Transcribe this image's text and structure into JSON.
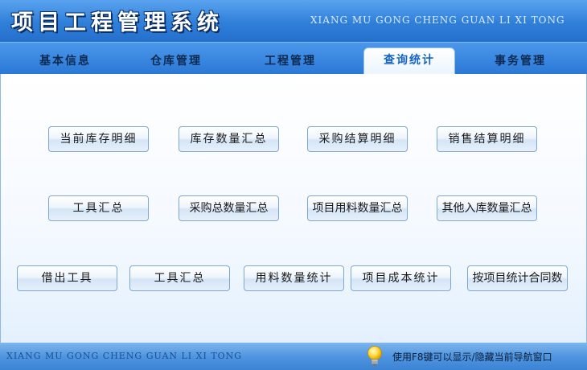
{
  "header": {
    "title": "项目工程管理系统",
    "subtitle": "XIANG MU GONG CHENG GUAN LI XI TONG"
  },
  "nav": {
    "tabs": [
      {
        "label": "基本信息"
      },
      {
        "label": "仓库管理"
      },
      {
        "label": "工程管理"
      },
      {
        "label": "查询统计"
      },
      {
        "label": "事务管理"
      }
    ],
    "active": "查询统计"
  },
  "buttons": {
    "current_stock_detail": "当前库存明细",
    "stock_quantity_summary": "库存数量汇总",
    "purchase_settlement_detail": "采购结算明细",
    "sales_settlement_detail": "销售结算明细",
    "tool_summary_1": "工具汇总",
    "purchase_total_quantity_summary": "采购总数量汇总",
    "project_material_quantity_summary": "项目用料数量汇总",
    "other_inbound_quantity_summary": "其他入库数量汇总",
    "borrowed_tools": "借出工具",
    "tool_summary_2": "工具汇总",
    "material_quantity_statistics": "用料数量统计",
    "project_cost_statistics": "项目成本统计",
    "contracts_by_project": "按项目统计合同数"
  },
  "footer": {
    "text": "XIANG MU GONG CHENG GUAN LI XI TONG",
    "hint": "使用F8键可以显示/隐藏当前导航窗口",
    "icon": "lightbulb-icon"
  },
  "colors": {
    "header_blue": "#2f7fd9",
    "active_tab_text": "#1565c0",
    "button_border": "#7fa7d3"
  }
}
